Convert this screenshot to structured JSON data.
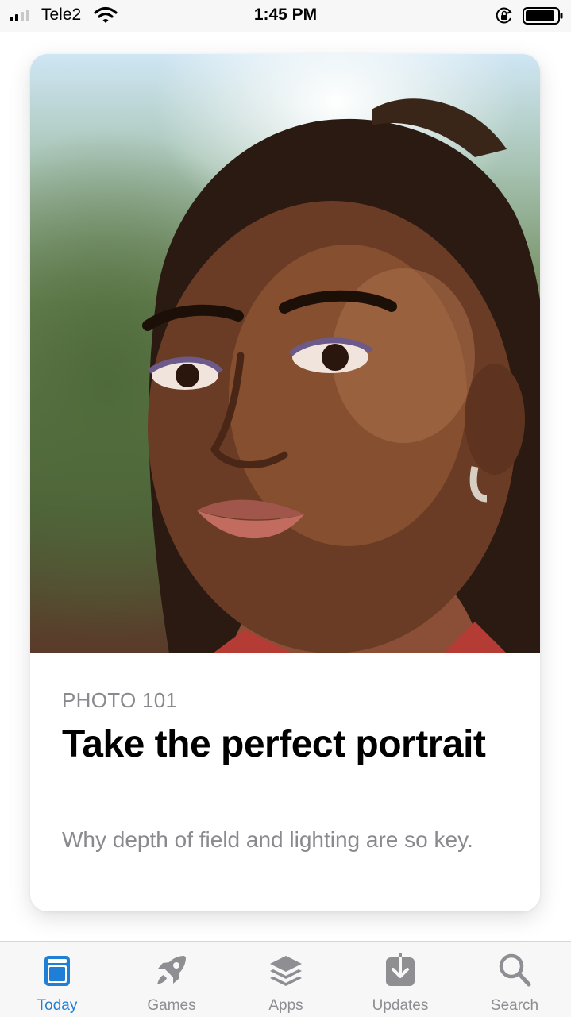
{
  "status_bar": {
    "carrier": "Tele2",
    "time": "1:45 PM",
    "signal_bars_filled": 2,
    "signal_bars_total": 4,
    "icons": [
      "signal-icon",
      "wifi-icon",
      "rotation-lock-icon",
      "battery-icon"
    ]
  },
  "card": {
    "image": "portrait-photo",
    "eyebrow": "PHOTO 101",
    "title": "Take the perfect portrait",
    "subtitle": "Why depth of field and lighting are so key."
  },
  "tab_bar": {
    "active": "Today",
    "accent_color": "#1f7fd6",
    "inactive_color": "#8e8e93",
    "tabs": [
      {
        "label": "Today",
        "icon": "today-icon"
      },
      {
        "label": "Games",
        "icon": "rocket-icon"
      },
      {
        "label": "Apps",
        "icon": "layers-icon"
      },
      {
        "label": "Updates",
        "icon": "download-icon"
      },
      {
        "label": "Search",
        "icon": "search-icon"
      }
    ]
  }
}
